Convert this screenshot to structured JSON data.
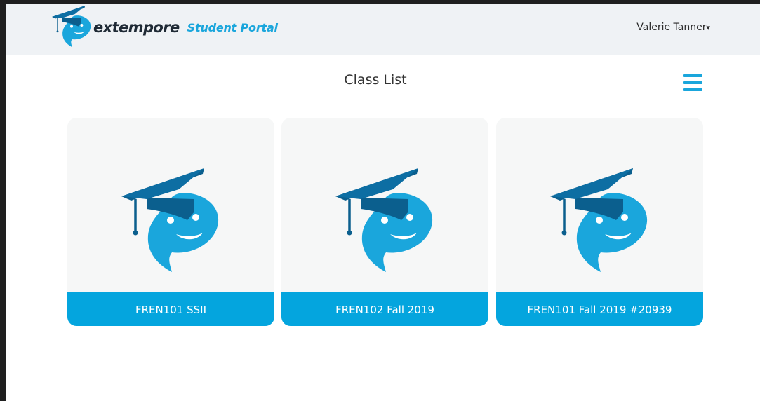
{
  "header": {
    "brand_name": "extempore",
    "brand_subtitle": "Student Portal",
    "user_name": "Valerie Tanner",
    "user_caret": "▾"
  },
  "main": {
    "title": "Class List",
    "classes": [
      {
        "label": "FREN101 SSII"
      },
      {
        "label": "FREN102 Fall 2019"
      },
      {
        "label": "FREN101 Fall 2019 #20939"
      }
    ]
  },
  "icons": {
    "logo": "graduation-cap-speech-bubble-icon",
    "menu": "hamburger-menu-icon"
  },
  "colors": {
    "accent": "#04a5de",
    "logo_light": "#1aa6dc",
    "logo_dark": "#0b5f8e",
    "header_bg": "#eff2f5",
    "card_bg": "#f6f7f7"
  }
}
